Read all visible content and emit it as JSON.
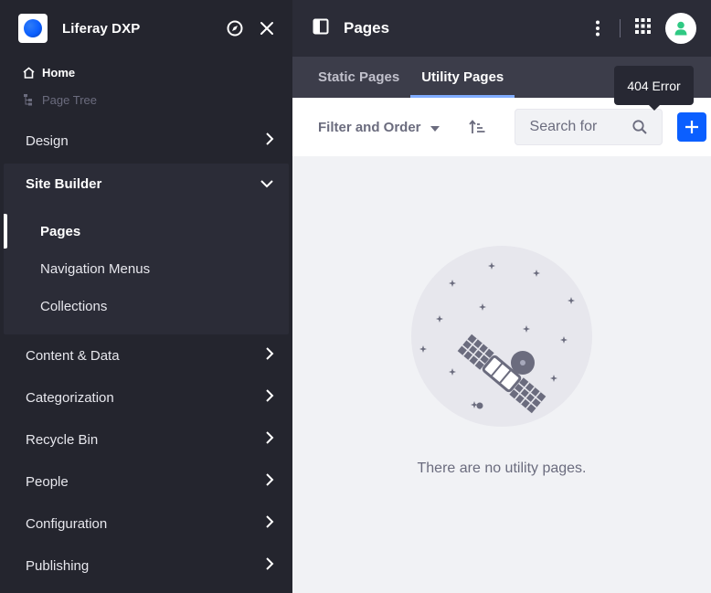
{
  "sidebar": {
    "app_title": "Liferay DXP",
    "home_label": "Home",
    "page_tree_label": "Page Tree",
    "design_label": "Design",
    "site_builder": {
      "label": "Site Builder",
      "items": [
        {
          "label": "Pages",
          "active": true
        },
        {
          "label": "Navigation Menus"
        },
        {
          "label": "Collections"
        }
      ]
    },
    "content_data_label": "Content & Data",
    "categorization_label": "Categorization",
    "recycle_bin_label": "Recycle Bin",
    "people_label": "People",
    "configuration_label": "Configuration",
    "publishing_label": "Publishing"
  },
  "header": {
    "title": "Pages"
  },
  "tabs": [
    {
      "label": "Static Pages"
    },
    {
      "label": "Utility Pages",
      "active": true
    }
  ],
  "toolbar": {
    "filter_label": "Filter and Order",
    "search_placeholder": "Search for",
    "add_tooltip": "404 Error"
  },
  "empty_state": {
    "message": "There are no utility pages."
  },
  "colors": {
    "primary": "#0b5fff",
    "sidebar_bg": "#24252e",
    "topbar_bg": "#2b2c37",
    "tab_active_underline": "#80acff",
    "avatar_icon": "#2fc983"
  }
}
